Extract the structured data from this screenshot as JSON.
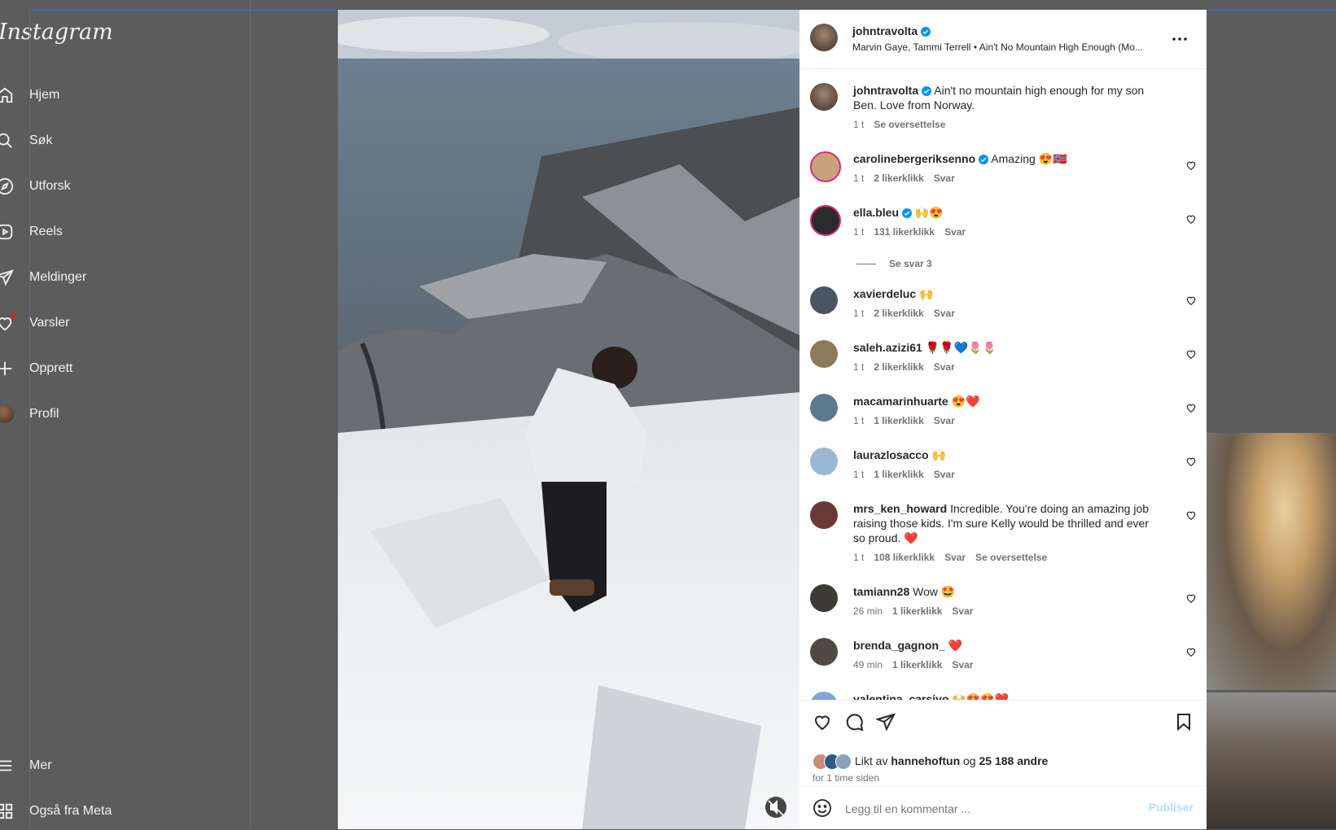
{
  "app": {
    "logo": "Instagram"
  },
  "sidebar": {
    "items": [
      {
        "label": "Hjem",
        "icon": "home-icon"
      },
      {
        "label": "Søk",
        "icon": "search-icon"
      },
      {
        "label": "Utforsk",
        "icon": "compass-icon"
      },
      {
        "label": "Reels",
        "icon": "reels-icon"
      },
      {
        "label": "Meldinger",
        "icon": "send-icon"
      },
      {
        "label": "Varsler",
        "icon": "heart-icon"
      },
      {
        "label": "Opprett",
        "icon": "plus-icon"
      },
      {
        "label": "Profil",
        "icon": "profile-avatar-icon"
      }
    ],
    "bottom": [
      {
        "label": "Mer",
        "icon": "menu-icon"
      },
      {
        "label": "Også fra Meta",
        "icon": "meta-grid-icon"
      }
    ]
  },
  "post": {
    "author": "johntravolta",
    "audio": "Marvin Gaye, Tammi Terrell • Ain't No Mountain High Enough (Mo...",
    "caption": {
      "user": "johntravolta",
      "text": "Ain't no mountain high enough for my son Ben. Love from Norway.",
      "time": "1 t",
      "translate": "Se oversettelse"
    },
    "comments": [
      {
        "user": "carolinebergeriksenno",
        "verified": true,
        "text": "Amazing 😍🇳🇴",
        "time": "1 t",
        "likes": "2 likerklikk",
        "reply": "Svar",
        "avatar_color": "#c9a27a"
      },
      {
        "user": "ella.bleu",
        "verified": true,
        "text": "🙌😍",
        "time": "1 t",
        "likes": "131 likerklikk",
        "reply": "Svar",
        "avatar_color": "#2b2b2b",
        "view_replies": "Se svar 3"
      },
      {
        "user": "xavierdeluc",
        "text": "🙌",
        "time": "1 t",
        "likes": "2 likerklikk",
        "reply": "Svar",
        "avatar_color": "#4a5562"
      },
      {
        "user": "saleh.azizi61",
        "text": "🌹🌹💙🌷🌷",
        "time": "1 t",
        "likes": "2 likerklikk",
        "reply": "Svar",
        "avatar_color": "#8b7b5a"
      },
      {
        "user": "macamarinhuarte",
        "text": "😍❤️",
        "time": "1 t",
        "likes": "1 likerklikk",
        "reply": "Svar",
        "avatar_color": "#5b7a8f"
      },
      {
        "user": "laurazlosacco",
        "text": "🙌",
        "time": "1 t",
        "likes": "1 likerklikk",
        "reply": "Svar",
        "avatar_color": "#9bb8d3"
      },
      {
        "user": "mrs_ken_howard",
        "text": "Incredible. You're doing an amazing job raising those kids. I'm sure Kelly would be thrilled and ever so proud. ❤️",
        "time": "1 t",
        "likes": "108 likerklikk",
        "reply": "Svar",
        "translate": "Se oversettelse",
        "avatar_color": "#6a3a3a"
      },
      {
        "user": "tamiann28",
        "text": "Wow 🤩",
        "time": "26 min",
        "likes": "1 likerklikk",
        "reply": "Svar",
        "avatar_color": "#3d3a36"
      },
      {
        "user": "brenda_gagnon_",
        "text": "❤️",
        "time": "49 min",
        "likes": "1 likerklikk",
        "reply": "Svar",
        "avatar_color": "#4f4a44"
      },
      {
        "user": "valentina_carsivo",
        "text": "🙌😍😍❤️",
        "avatar_color": "#7ea6d8"
      }
    ],
    "liked_by_prefix": "Likt av",
    "liked_by_user": "hannehoftun",
    "liked_by_and": "og",
    "liked_by_others": "25 188 andre",
    "posted_ago": "for 1 time siden",
    "comment_placeholder": "Legg til en kommentar ...",
    "publish_label": "Publiser"
  },
  "colors": {
    "overlay": "#5c5c5c",
    "verified": "#0095f6",
    "publish": "#b2dffc",
    "notification_dot": "#ff3040"
  }
}
